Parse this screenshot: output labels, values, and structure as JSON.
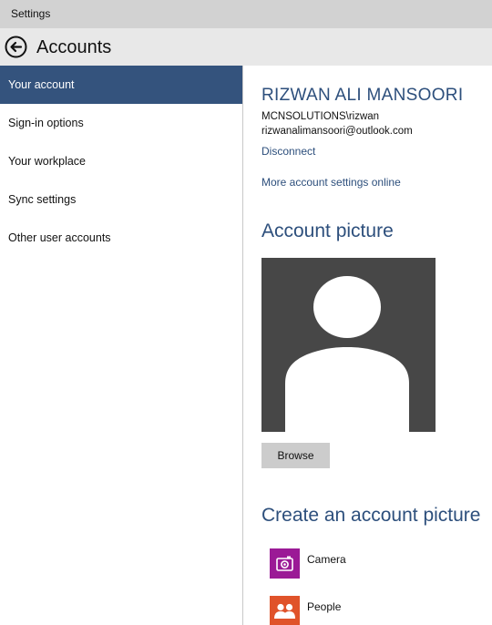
{
  "window": {
    "title": "Settings"
  },
  "header": {
    "title": "Accounts",
    "back_icon": "back-arrow-icon"
  },
  "sidebar": {
    "items": [
      {
        "label": "Your account",
        "selected": true
      },
      {
        "label": "Sign-in options",
        "selected": false
      },
      {
        "label": "Your workplace",
        "selected": false
      },
      {
        "label": "Sync settings",
        "selected": false
      },
      {
        "label": "Other user accounts",
        "selected": false
      }
    ]
  },
  "account": {
    "name": "RIZWAN ALI MANSOORI",
    "domain_user": "MCNSOLUTIONS\\rizwan",
    "email": "rizwanalimansoori@outlook.com",
    "disconnect_label": "Disconnect",
    "more_settings_label": "More account settings online"
  },
  "account_picture": {
    "heading": "Account picture",
    "browse_label": "Browse"
  },
  "create_picture": {
    "heading": "Create an account picture",
    "apps": [
      {
        "label": "Camera",
        "icon": "camera-icon",
        "color": "#9b1a96"
      },
      {
        "label": "People",
        "icon": "people-icon",
        "color": "#e0532a"
      }
    ]
  },
  "colors": {
    "accent": "#2d4f7c",
    "selected_bg": "#34537d",
    "titlebar_bg": "#d2d2d2",
    "header_bg": "#e8e8e8"
  }
}
